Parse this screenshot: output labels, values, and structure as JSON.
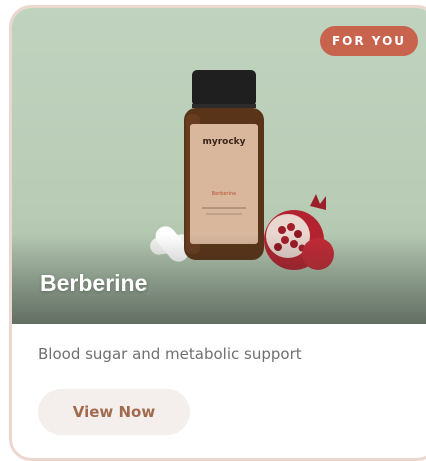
{
  "card": {
    "badge_label": "FOR YOU",
    "product_name": "Berberine",
    "description": "Blood sugar and metabolic support",
    "cta_label": "View Now"
  },
  "product_image": {
    "brand_text": "myrocky",
    "label_text": "Berberine"
  },
  "colors": {
    "hero_background": "#bcd0bb",
    "badge": "#c8634e",
    "cta_background": "#f4efec",
    "cta_text": "#a06b4e",
    "card_border": "#ecd7d0"
  }
}
